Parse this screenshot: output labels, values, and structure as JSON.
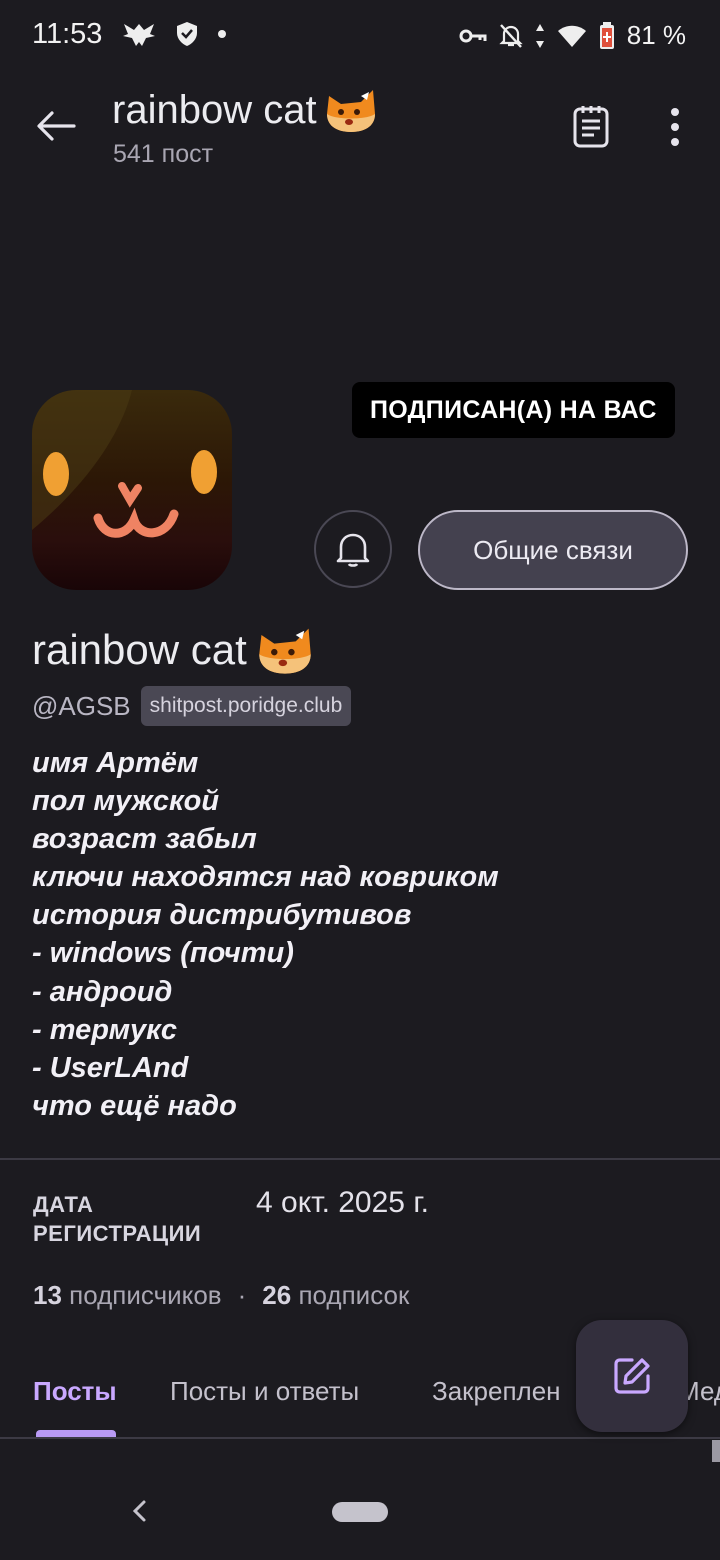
{
  "status_bar": {
    "time": "11:53",
    "battery": "81 %",
    "icons": [
      "eagle-icon",
      "shield-icon",
      "dot-icon",
      "vpn-key-icon",
      "notifications-off-icon",
      "data-arrows-icon",
      "wifi-icon",
      "battery-icon"
    ]
  },
  "app_bar": {
    "title": "rainbow cat",
    "subtitle": "541 пост",
    "back_icon": "back-arrow-icon",
    "notes_icon": "notes-icon",
    "more_icon": "more-vert-icon"
  },
  "profile": {
    "follows_you_badge": "ПОДПИСАН(А) НА ВАС",
    "bell_icon": "bell-icon",
    "mutuals_button": "Общие связи",
    "display_name": "rainbow cat",
    "handle": "@AGSB",
    "instance": "shitpost.poridge.club",
    "bio": [
      "имя Артём",
      "пол мужской",
      "возраст забыл",
      "ключи находятся над ковриком",
      "история дистрибутивов",
      "- windows (почти)",
      "- андроид",
      "- термукс",
      "- UserLAnd",
      "что ещё надо"
    ]
  },
  "registration": {
    "label_line1": "ДАТА",
    "label_line2": "РЕГИСТРАЦИИ",
    "date": "4 окт. 2025 г."
  },
  "counts": {
    "followers_num": "13",
    "followers_label": "подписчиков",
    "separator": "·",
    "following_num": "26",
    "following_label": "подписок"
  },
  "tabs": [
    {
      "label": "Посты",
      "active": true
    },
    {
      "label": "Посты и ответы",
      "active": false
    },
    {
      "label": "Закреплен",
      "active": false
    },
    {
      "label": "Мед",
      "active": false
    }
  ],
  "fab_icon": "compose-icon",
  "colors": {
    "background": "#1c1b20",
    "accent": "#c9a8ff",
    "badge_bg": "#000000"
  }
}
